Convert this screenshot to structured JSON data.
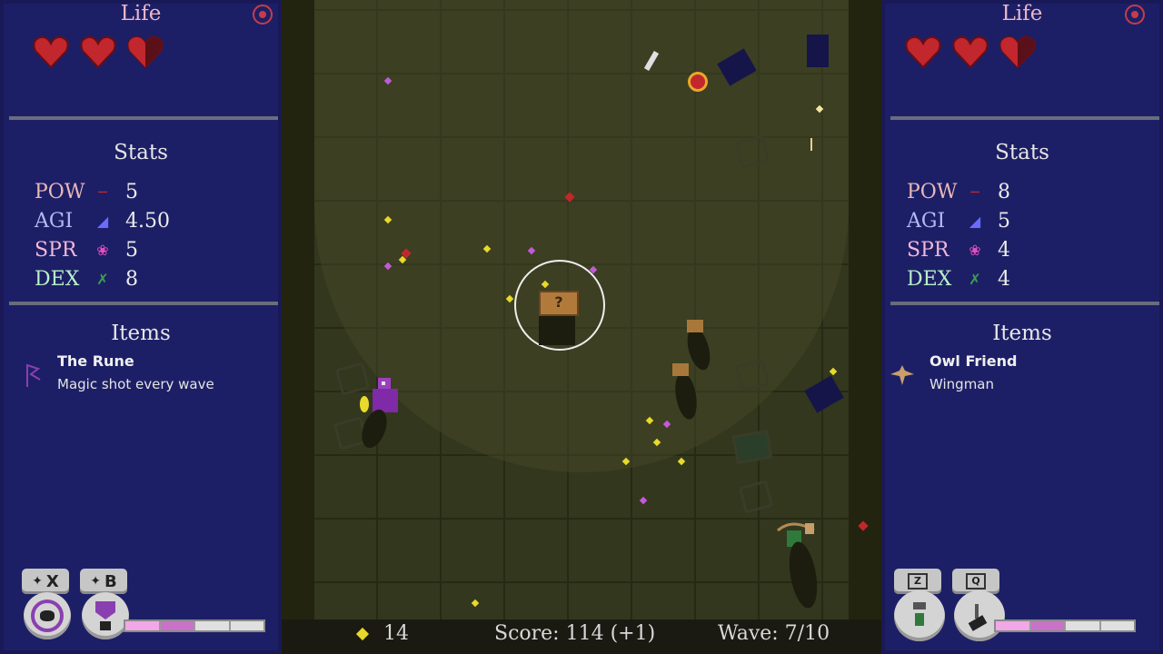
{
  "players": [
    {
      "life_title": "Life",
      "hearts": [
        "full",
        "full",
        "half"
      ],
      "stats_title": "Stats",
      "stats": [
        {
          "label": "POW",
          "icon": "sword-icon",
          "value": "5"
        },
        {
          "label": "AGI",
          "icon": "boot-icon",
          "value": "4.50"
        },
        {
          "label": "SPR",
          "icon": "spirit-icon",
          "value": "5"
        },
        {
          "label": "DEX",
          "icon": "crossed-arrows-icon",
          "value": "8"
        }
      ],
      "items_title": "Items",
      "item": {
        "name": "The Rune",
        "desc": "Magic shot every wave",
        "icon": "rune-icon"
      },
      "buttons": [
        {
          "label": "X"
        },
        {
          "label": "B"
        }
      ],
      "charge": 0.5
    },
    {
      "life_title": "Life",
      "hearts": [
        "full",
        "full",
        "half"
      ],
      "stats_title": "Stats",
      "stats": [
        {
          "label": "POW",
          "icon": "sword-icon",
          "value": "8"
        },
        {
          "label": "AGI",
          "icon": "boot-icon",
          "value": "5"
        },
        {
          "label": "SPR",
          "icon": "spirit-icon",
          "value": "4"
        },
        {
          "label": "DEX",
          "icon": "crossed-arrows-icon",
          "value": "4"
        }
      ],
      "items_title": "Items",
      "item": {
        "name": "Owl Friend",
        "desc": "Wingman",
        "icon": "owl-icon"
      },
      "buttons": [
        {
          "label": "Z"
        },
        {
          "label": "Q"
        }
      ],
      "charge": 0.45
    }
  ],
  "hud": {
    "gems": "14",
    "score": "Score: 114 (+1)",
    "wave": "Wave: 7/10"
  },
  "colors": {
    "panel": "#1d1f66",
    "heart": "#c1272d",
    "gem": "#e8d92a"
  }
}
